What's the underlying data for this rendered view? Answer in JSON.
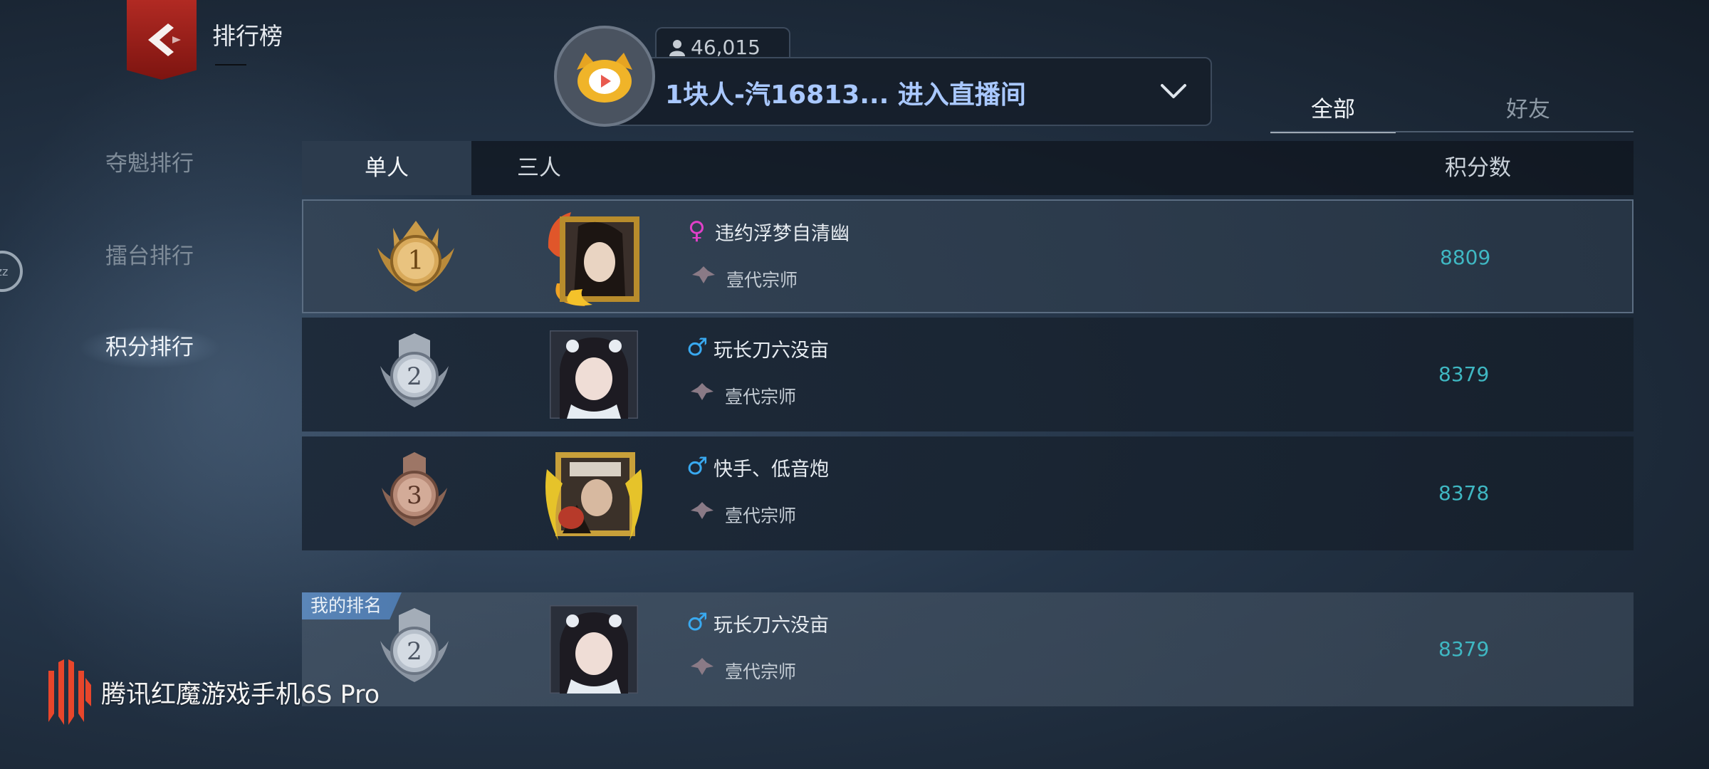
{
  "header": {
    "title": "排行榜"
  },
  "side_nav": {
    "items": [
      "夺魁排行",
      "擂台排行",
      "积分排行"
    ],
    "active_index": 2
  },
  "edge_bubble": {
    "label": "zz"
  },
  "live": {
    "viewer_count": "46,015",
    "text": "1块人-汽16813... 进入直播间"
  },
  "filter_tabs": {
    "items": [
      "全部",
      "好友"
    ],
    "active_index": 0
  },
  "table": {
    "mode_tabs": [
      "单人",
      "三人"
    ],
    "active_mode": 0,
    "score_header": "积分数"
  },
  "rows": [
    {
      "rank": "1",
      "gender": "♀",
      "name": "违约浮梦自清幽",
      "title": "壹代宗师",
      "score": "8809"
    },
    {
      "rank": "2",
      "gender": "♂",
      "name": "玩长刀六没亩",
      "title": "壹代宗师",
      "score": "8379"
    },
    {
      "rank": "3",
      "gender": "♂",
      "name": "快手、低音炮",
      "title": "壹代宗师",
      "score": "8378"
    }
  ],
  "my_rank": {
    "tag": "我的排名",
    "rank": "2",
    "gender": "♂",
    "name": "玩长刀六没亩",
    "title": "壹代宗师",
    "score": "8379"
  },
  "watermark": {
    "text": "腾讯红魔游戏手机6S Pro"
  },
  "colors": {
    "score": "#3fb7c2",
    "female": "#e040c8",
    "male": "#39a9f0",
    "live_text": "#a9c8ff",
    "back_badge": "#b12a23"
  }
}
